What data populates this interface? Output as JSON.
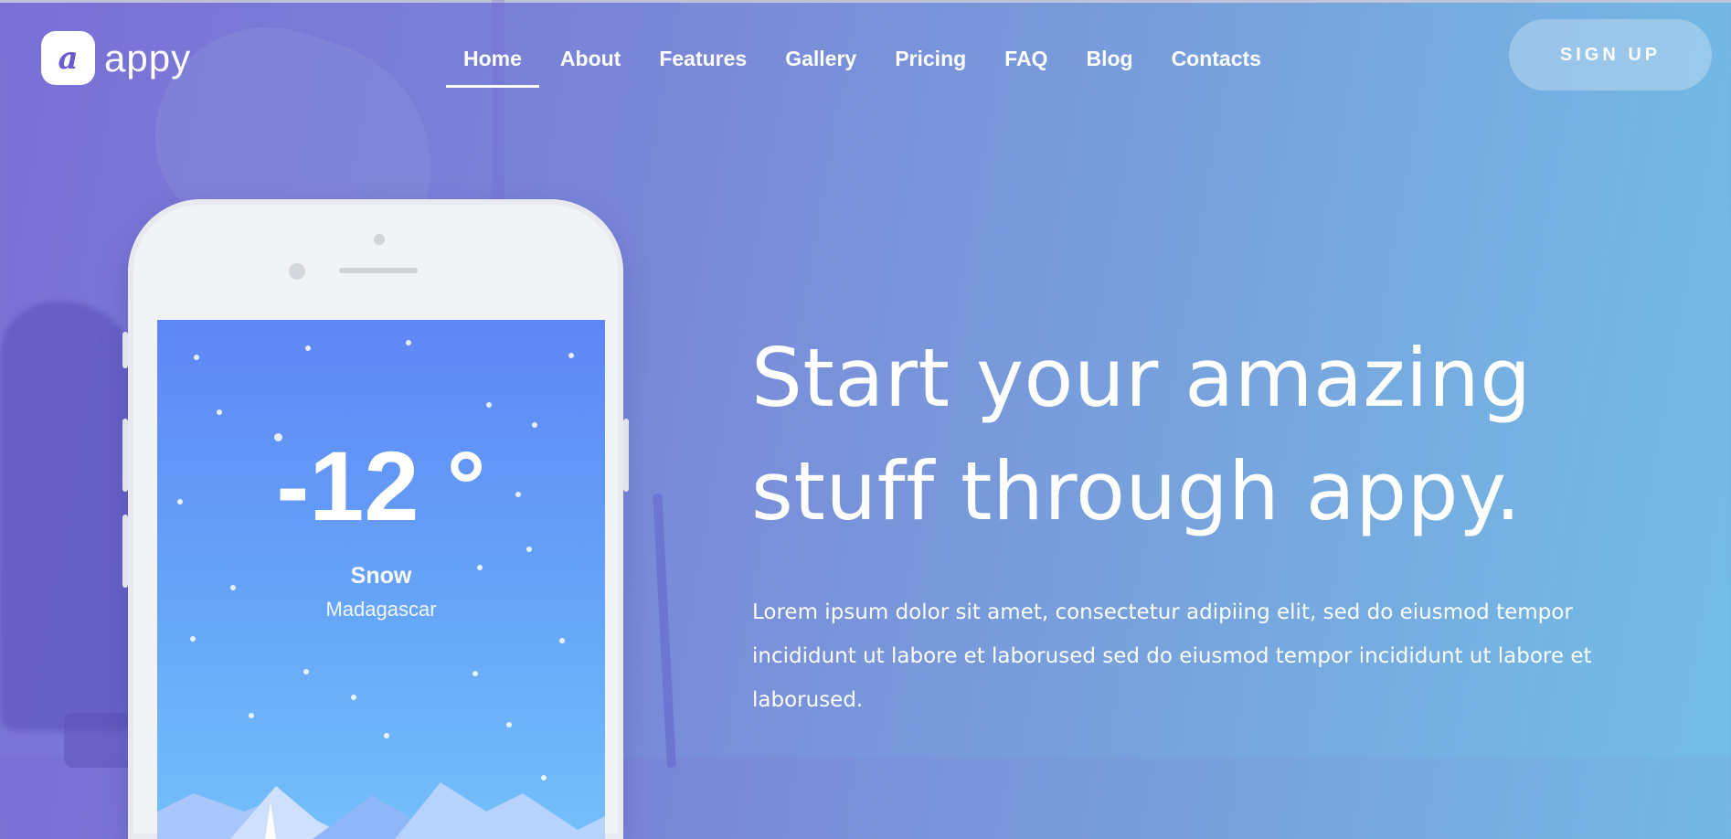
{
  "brand": {
    "logo_letter": "a",
    "name": "appy"
  },
  "nav": {
    "items": [
      {
        "label": "Home",
        "active": true
      },
      {
        "label": "About"
      },
      {
        "label": "Features"
      },
      {
        "label": "Gallery"
      },
      {
        "label": "Pricing"
      },
      {
        "label": "FAQ"
      },
      {
        "label": "Blog"
      },
      {
        "label": "Contacts"
      }
    ],
    "signup_label": "SIGN UP"
  },
  "phone": {
    "temperature": "-12 °",
    "condition": "Snow",
    "location": "Madagascar"
  },
  "hero": {
    "title_line1": "Start your amazing",
    "title_line2": "stuff through appy.",
    "text": "Lorem ipsum dolor sit amet, consectetur adipiing elit, sed do eiusmod tempor incididunt ut labore et laborused sed do eiusmod tempor incididunt ut labore et laborused."
  },
  "colors": {
    "bg_left": "#7a6fd6",
    "bg_right": "#73bde6",
    "logo_accent": "#6b5bd0",
    "screen_top": "#5f86f6",
    "screen_bottom": "#74c0fb"
  }
}
